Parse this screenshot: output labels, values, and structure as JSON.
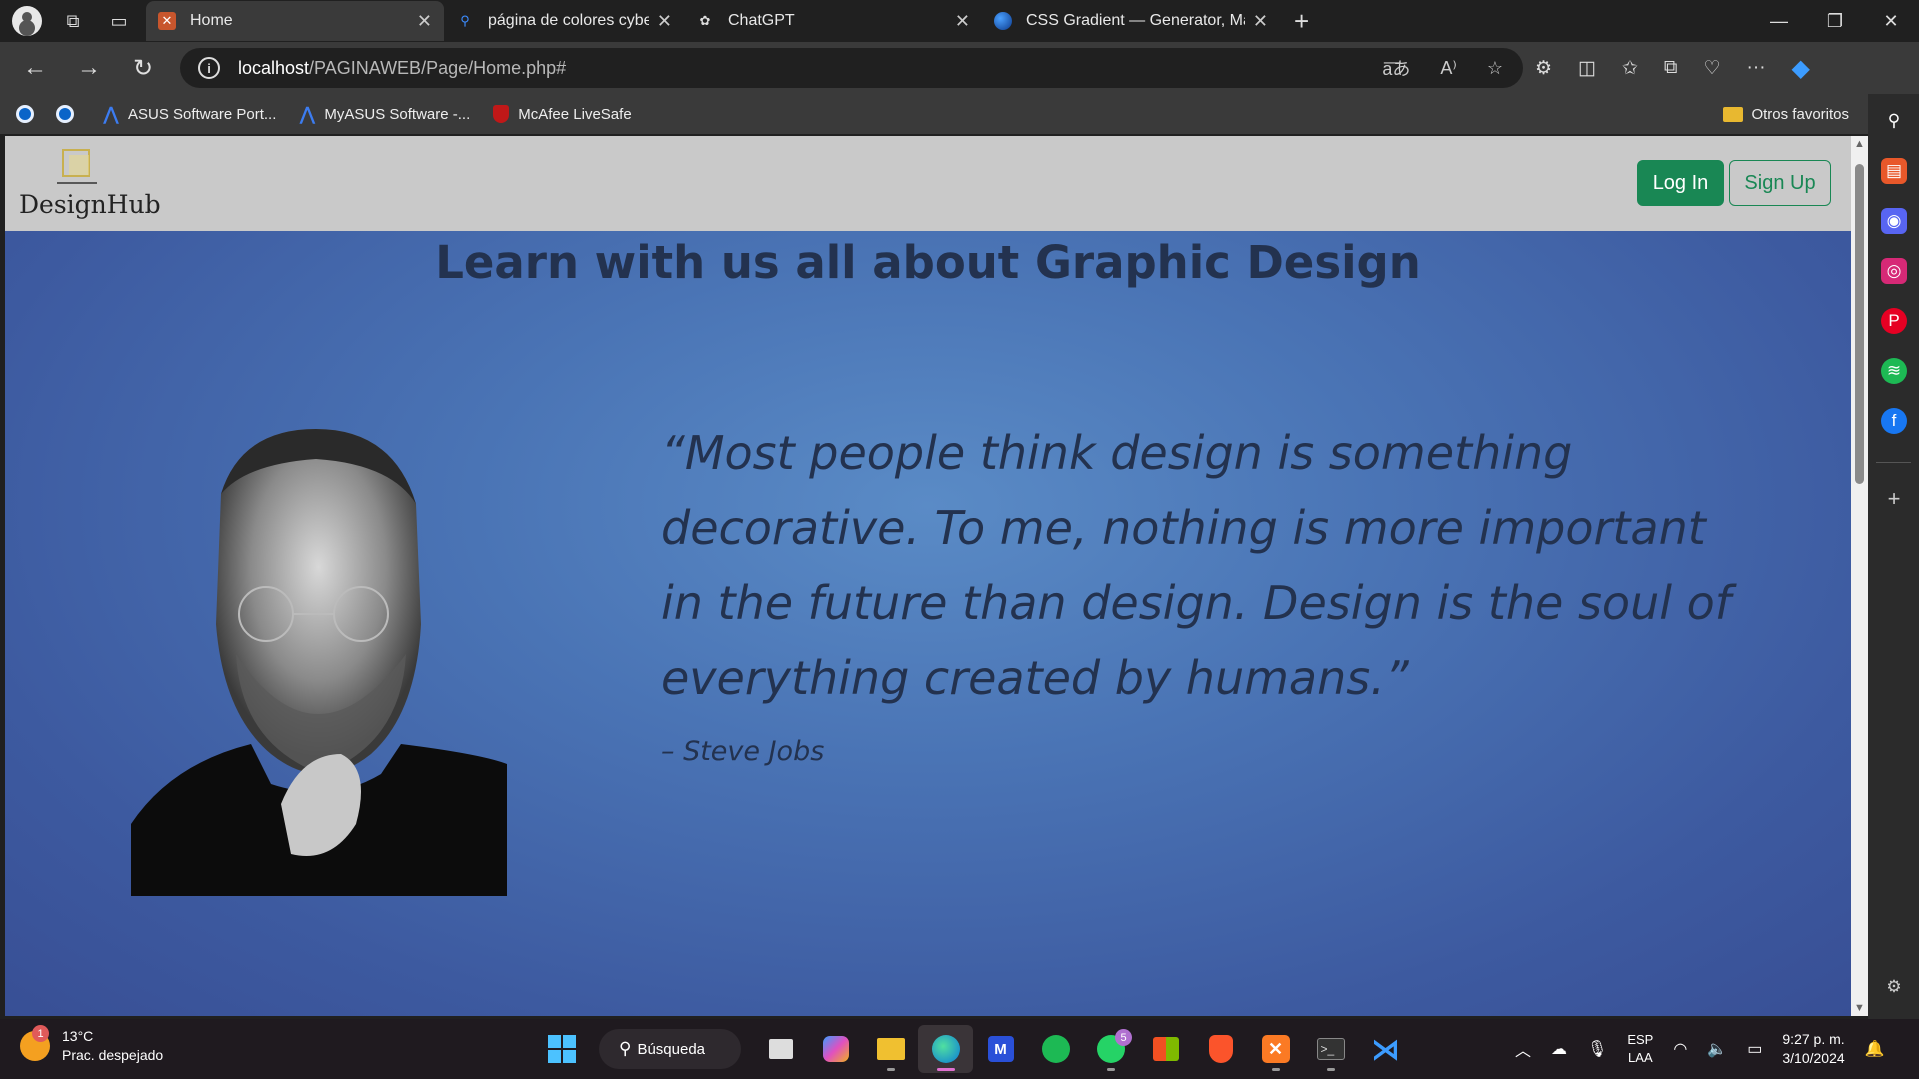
{
  "browser": {
    "tabs": [
      {
        "title": "Home",
        "active": true
      },
      {
        "title": "página de colores cyberpunk - Bú",
        "active": false
      },
      {
        "title": "ChatGPT",
        "active": false
      },
      {
        "title": "CSS Gradient — Generator, Maker",
        "active": false
      }
    ],
    "address": {
      "host": "localhost",
      "path": "/PAGINAWEB/Page/Home.php#"
    },
    "bookmarks": [
      {
        "label": "ASUS Software Port..."
      },
      {
        "label": "MyASUS Software -..."
      },
      {
        "label": "McAfee LiveSafe"
      }
    ],
    "other_favorites": "Otros favoritos"
  },
  "site": {
    "logo_text": "DesignHub",
    "login_label": "Log In",
    "signup_label": "Sign Up",
    "hero_title": "Learn with us all about Graphic Design",
    "quote": "“Most people think design is something decorative. To me, nothing is more important in the future than design. Design is the soul of everything created by humans.”",
    "attribution": "– Steve Jobs",
    "accent_color": "#198754"
  },
  "taskbar": {
    "weather_temp": "13°C",
    "weather_desc": "Prac. despejado",
    "weather_badge": "1",
    "search_label": "Búsqueda",
    "whatsapp_badge": "5",
    "lang_line1": "ESP",
    "lang_line2": "LAA",
    "time": "9:27 p. m.",
    "date": "3/10/2024"
  }
}
